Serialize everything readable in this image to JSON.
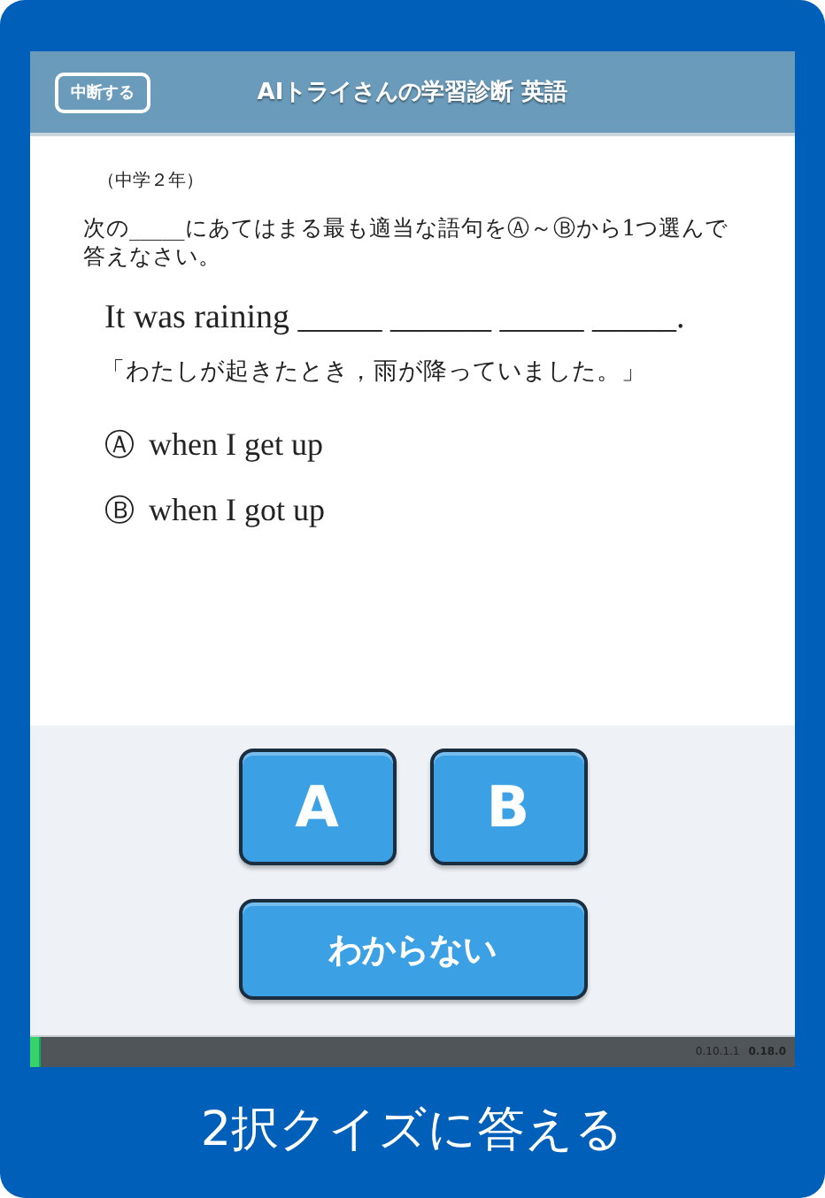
{
  "header": {
    "button": "中断する",
    "title": "AIトライさんの学習診断 英語"
  },
  "question": {
    "grade": "（中学２年）",
    "instruction": "次の_____にあてはまる最も適当な語句をⒶ～Ⓑから1つ選んで答えなさい。",
    "sentence": "It was raining _____ ______ _____ _____.",
    "translation": "「わたしが起きたとき，雨が降っていました。」",
    "choices": [
      {
        "mark": "Ⓐ",
        "text": "when I get up"
      },
      {
        "mark": "Ⓑ",
        "text": "when I got up"
      }
    ]
  },
  "answer_buttons": [
    {
      "label": "A",
      "kind": "small"
    },
    {
      "label": "B",
      "kind": "small"
    },
    {
      "label": "わからない",
      "kind": "wide"
    }
  ],
  "footer": {
    "progress": {
      "level": 0.015
    },
    "version_1": "0.10.1.1",
    "version_2": "0.18.0"
  },
  "caption": "2択クイズに答える"
}
